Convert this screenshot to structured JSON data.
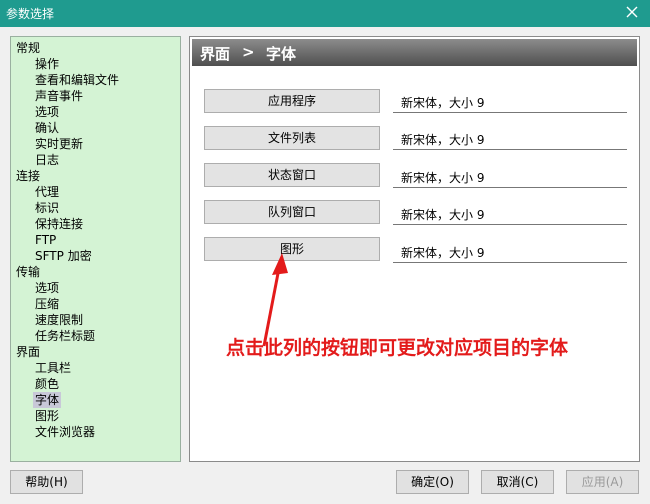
{
  "window": {
    "title": "参数选择",
    "close_icon": "close-icon"
  },
  "tree": {
    "groups": [
      {
        "label": "常规",
        "items": [
          "操作",
          "查看和编辑文件",
          "声音事件",
          "选项",
          "确认",
          "实时更新",
          "日志"
        ]
      },
      {
        "label": "连接",
        "items": [
          "代理",
          "标识",
          "保持连接",
          "FTP",
          "SFTP 加密"
        ]
      },
      {
        "label": "传输",
        "items": [
          "选项",
          "压缩",
          "速度限制",
          "任务栏标题"
        ]
      },
      {
        "label": "界面",
        "items": [
          "工具栏",
          "颜色",
          "字体",
          "图形",
          "文件浏览器"
        ]
      }
    ],
    "selected": "字体"
  },
  "panel": {
    "header_title": "界面",
    "header_separator": ">",
    "header_subtitle": "字体",
    "fonts": [
      {
        "button": "应用程序",
        "value": "新宋体，大小 9"
      },
      {
        "button": "文件列表",
        "value": "新宋体，大小 9"
      },
      {
        "button": "状态窗口",
        "value": "新宋体，大小 9"
      },
      {
        "button": "队列窗口",
        "value": "新宋体，大小 9"
      },
      {
        "button": "图形",
        "value": "新宋体，大小 9"
      }
    ],
    "annotation": "点击此列的按钮即可更改对应项目的字体",
    "annotation_color": "#e31b1b"
  },
  "buttons": {
    "help": "帮助(H)",
    "ok": "确定(O)",
    "cancel": "取消(C)",
    "apply": "应用(A)"
  },
  "colors": {
    "titlebar": "#1f9b8f",
    "tree_bg": "#d4f3d4"
  }
}
